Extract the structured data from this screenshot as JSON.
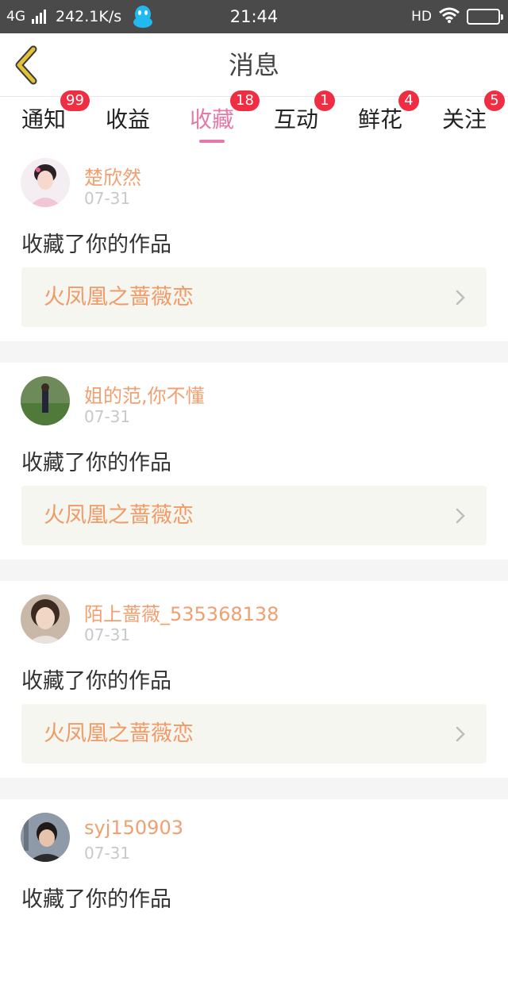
{
  "status_bar": {
    "network": "4G",
    "speed": "242.1K/s",
    "time": "21:44",
    "hd": "HD"
  },
  "header": {
    "title": "消息"
  },
  "tabs": [
    {
      "label": "通知",
      "badge": "99"
    },
    {
      "label": "收益",
      "badge": ""
    },
    {
      "label": "收藏",
      "badge": "18",
      "active": true
    },
    {
      "label": "互动",
      "badge": "1"
    },
    {
      "label": "鲜花",
      "badge": "4"
    },
    {
      "label": "关注",
      "badge": "5"
    }
  ],
  "messages": [
    {
      "user": "楚欣然",
      "date": "07-31",
      "action": "收藏了你的作品",
      "work": "火凤凰之蔷薇恋"
    },
    {
      "user": "姐的范,你不懂",
      "date": "07-31",
      "action": "收藏了你的作品",
      "work": "火凤凰之蔷薇恋"
    },
    {
      "user": "陌上蔷薇_535368138",
      "date": "07-31",
      "action": "收藏了你的作品",
      "work": "火凤凰之蔷薇恋"
    },
    {
      "user": "syj150903",
      "date": "07-31",
      "action": "收藏了你的作品",
      "work": ""
    }
  ],
  "colors": {
    "status_bar_bg": "#4a4a4a",
    "accent_pink": "#e37aa9",
    "badge_red": "#ef2d43",
    "name_orange": "#f0a070",
    "back_arrow_yellow": "#e3c238"
  },
  "icons": {
    "back": "back-arrow-icon",
    "chevron": "chevron-right-icon",
    "qq": "qq-penguin-icon",
    "wifi": "wifi-icon",
    "battery": "battery-icon"
  }
}
